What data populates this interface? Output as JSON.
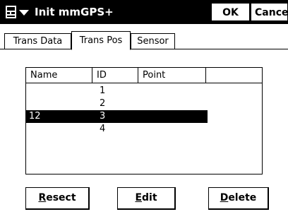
{
  "titlebar": {
    "start_icon": "windows-start-menu-icon",
    "title": "Init mmGPS+",
    "ok_label": "OK",
    "cancel_label": "Cancel"
  },
  "tabs": [
    {
      "label": "Trans Data",
      "active": false
    },
    {
      "label": "Trans Pos",
      "active": true
    },
    {
      "label": "Sensor",
      "active": false
    }
  ],
  "table": {
    "columns": [
      "Name",
      "ID",
      "Point",
      ""
    ],
    "rows": [
      {
        "name": "",
        "id": "1",
        "point": "",
        "selected": false
      },
      {
        "name": "",
        "id": "2",
        "point": "",
        "selected": false
      },
      {
        "name": "12",
        "id": "3",
        "point": "",
        "selected": true
      },
      {
        "name": "",
        "id": "4",
        "point": "",
        "selected": false
      }
    ]
  },
  "buttons": {
    "resect": {
      "mnemonic": "R",
      "rest": "esect"
    },
    "edit": {
      "mnemonic": "E",
      "rest": "dit"
    },
    "delete": {
      "mnemonic": "D",
      "rest": "elete"
    }
  }
}
